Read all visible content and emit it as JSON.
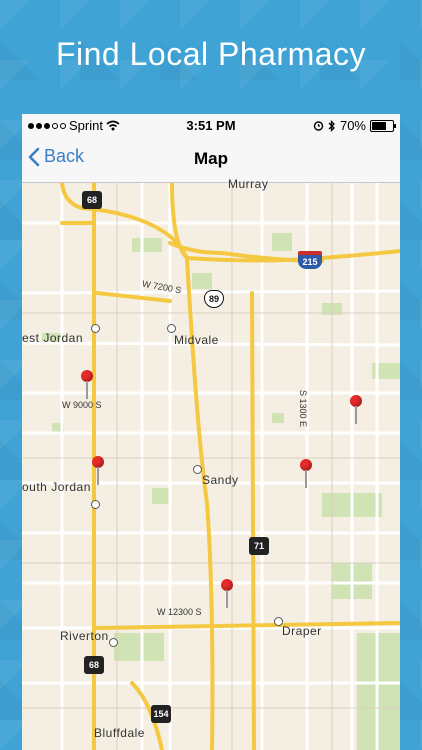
{
  "headline": "Find Local Pharmacy",
  "status_bar": {
    "carrier": "Sprint",
    "signal_bars_filled": 3,
    "signal_bars_total": 5,
    "time": "3:51 PM",
    "battery_percent_label": "70%",
    "battery_level": 0.7,
    "icons": [
      "wifi-icon",
      "alarm-icon",
      "bluetooth-icon",
      "battery-icon"
    ]
  },
  "nav": {
    "back_label": "Back",
    "title": "Map"
  },
  "map": {
    "places": [
      "Murray",
      "est Jordan",
      "Midvale",
      "Sandy",
      "outh Jordan",
      "Riverton",
      "Draper",
      "Bluffdale"
    ],
    "road_labels": [
      "W 7200 S",
      "W 9000 S",
      "S 1300 E",
      "W 12300 S"
    ],
    "shields": [
      "68",
      "89",
      "215",
      "71",
      "68",
      "154"
    ],
    "pins_count": 5
  },
  "colors": {
    "background": "#3fa3d6",
    "accent": "#3a7ec6",
    "pin": "#e62a2a",
    "highway": "#f5c842"
  }
}
